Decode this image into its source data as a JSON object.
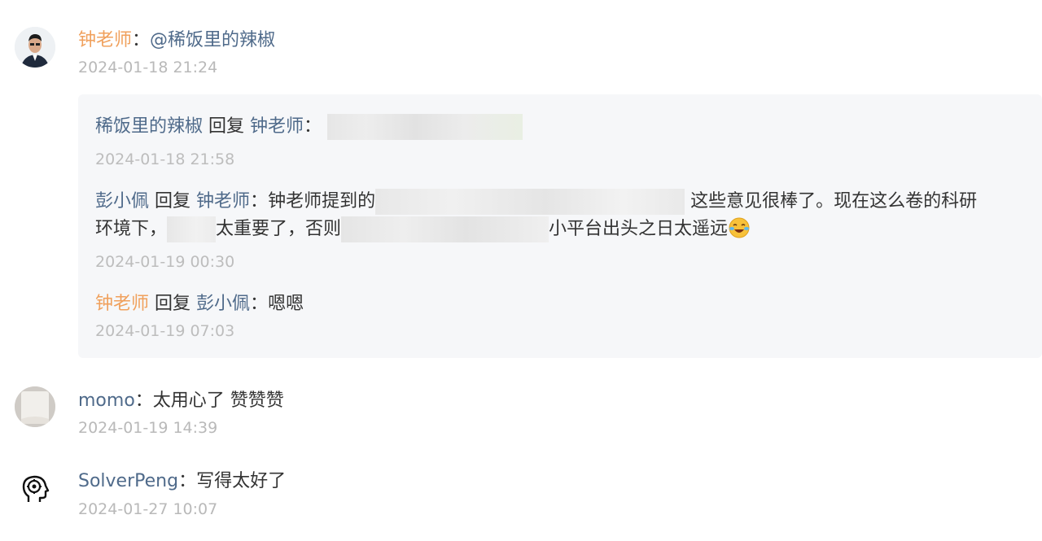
{
  "colors": {
    "author": "#f0a05c",
    "user": "#4f6a8a",
    "date": "#b9b9b9",
    "reply_bg": "#f6f7f9"
  },
  "comments": [
    {
      "author": "钟老师",
      "sep": "：",
      "mention": "@稀饭里的辣椒",
      "date": "2024-01-18 21:24",
      "avatar": "person-avatar",
      "replies": [
        {
          "user": "稀饭里的辣椒",
          "action": "回复",
          "target": "钟老师",
          "sep": "：",
          "text": "",
          "date": "2024-01-18 21:58"
        },
        {
          "user": "彭小佩",
          "action": "回复",
          "target": "钟老师",
          "sep": "：",
          "text_a": "钟老师提到的",
          "text_b": "这些意见很棒了。现在这么卷的科研",
          "text_c": "环境下，",
          "text_d": "太重要了，否则",
          "text_e": "小平台出头之日太遥远",
          "date": "2024-01-19 00:30"
        },
        {
          "user": "钟老师",
          "action": "回复",
          "target": "彭小佩",
          "sep": "：",
          "text": "嗯嗯",
          "date": "2024-01-19 07:03"
        }
      ]
    },
    {
      "author": "momo",
      "sep": "：",
      "text": "太用心了 赞赞赞",
      "date": "2024-01-19 14:39",
      "avatar": "blank-avatar"
    },
    {
      "author": "SolverPeng",
      "sep": "：",
      "text": "写得太好了",
      "date": "2024-01-27 10:07",
      "avatar": "brain-head-avatar"
    }
  ]
}
